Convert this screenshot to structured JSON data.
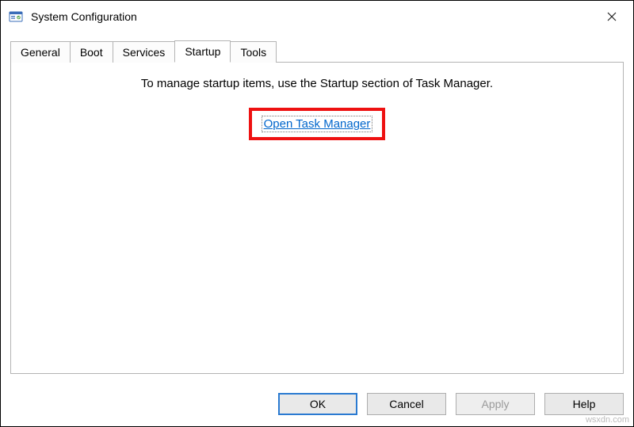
{
  "window": {
    "title": "System Configuration"
  },
  "tabs": {
    "general": "General",
    "boot": "Boot",
    "services": "Services",
    "startup": "Startup",
    "tools": "Tools"
  },
  "main": {
    "info": "To manage startup items, use the Startup section of Task Manager.",
    "link": "Open Task Manager"
  },
  "buttons": {
    "ok": "OK",
    "cancel": "Cancel",
    "apply": "Apply",
    "help": "Help"
  },
  "watermark": "wsxdn.com"
}
